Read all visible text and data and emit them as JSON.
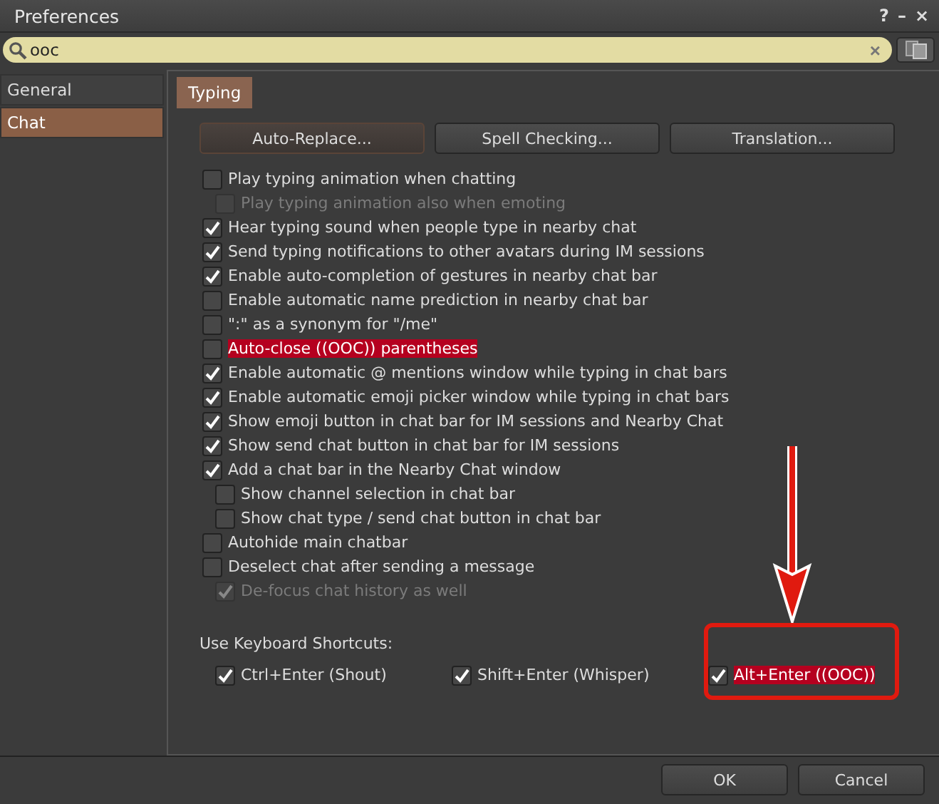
{
  "window": {
    "title": "Preferences",
    "controls": [
      "?",
      "–",
      "×"
    ]
  },
  "search": {
    "value": "ooc",
    "clear": "×"
  },
  "sidebar": {
    "items": [
      {
        "label": "General",
        "selected": false
      },
      {
        "label": "Chat",
        "selected": true
      }
    ]
  },
  "tabs": [
    {
      "label": "Typing",
      "selected": true
    }
  ],
  "buttons": [
    "Auto-Replace...",
    "Spell Checking...",
    "Translation..."
  ],
  "options": [
    {
      "label": "Play typing animation when chatting",
      "checked": false,
      "disabled": false,
      "highlighted": false,
      "children": [
        {
          "label": "Play typing animation also when emoting",
          "checked": false,
          "disabled": true,
          "highlighted": false
        }
      ]
    },
    {
      "label": "Hear typing sound when people type in nearby chat",
      "checked": true,
      "disabled": false,
      "highlighted": false
    },
    {
      "label": "Send typing notifications to other avatars during IM sessions",
      "checked": true,
      "disabled": false,
      "highlighted": false
    },
    {
      "label": "Enable auto-completion of gestures in nearby chat bar",
      "checked": true,
      "disabled": false,
      "highlighted": false
    },
    {
      "label": "Enable automatic name prediction in nearby chat bar",
      "checked": false,
      "disabled": false,
      "highlighted": false
    },
    {
      "label": "\":\" as a synonym for \"/me\"",
      "checked": false,
      "disabled": false,
      "highlighted": false
    },
    {
      "label": "Auto-close ((OOC)) parentheses",
      "checked": false,
      "disabled": false,
      "highlighted": true
    },
    {
      "label": "Enable automatic @ mentions window while typing in chat bars",
      "checked": true,
      "disabled": false,
      "highlighted": false
    },
    {
      "label": "Enable automatic emoji picker window while typing in chat bars",
      "checked": true,
      "disabled": false,
      "highlighted": false
    },
    {
      "label": "Show emoji button in chat bar for IM sessions and Nearby Chat",
      "checked": true,
      "disabled": false,
      "highlighted": false
    },
    {
      "label": "Show send chat button in chat bar for IM sessions",
      "checked": true,
      "disabled": false,
      "highlighted": false
    },
    {
      "label": "Add a chat bar in the Nearby Chat window",
      "checked": true,
      "disabled": false,
      "highlighted": false,
      "children": [
        {
          "label": "Show channel selection in chat bar",
          "checked": false,
          "disabled": false,
          "highlighted": false
        },
        {
          "label": "Show chat type / send chat button in chat bar",
          "checked": false,
          "disabled": false,
          "highlighted": false
        }
      ]
    },
    {
      "label": "Autohide main chatbar",
      "checked": false,
      "disabled": false,
      "highlighted": false
    },
    {
      "label": "Deselect chat after sending a message",
      "checked": false,
      "disabled": false,
      "highlighted": false,
      "children": [
        {
          "label": "De-focus chat history as well",
          "checked": true,
          "disabled": true,
          "highlighted": false
        }
      ]
    }
  ],
  "shortcuts": {
    "label": "Use Keyboard Shortcuts:",
    "items": [
      {
        "label": "Ctrl+Enter (Shout)",
        "checked": true,
        "highlighted": false
      },
      {
        "label": "Shift+Enter (Whisper)",
        "checked": true,
        "highlighted": false
      },
      {
        "label": "Alt+Enter ((OOC))",
        "checked": true,
        "highlighted": true
      }
    ]
  },
  "footer": {
    "buttons": [
      "OK",
      "Cancel"
    ]
  }
}
